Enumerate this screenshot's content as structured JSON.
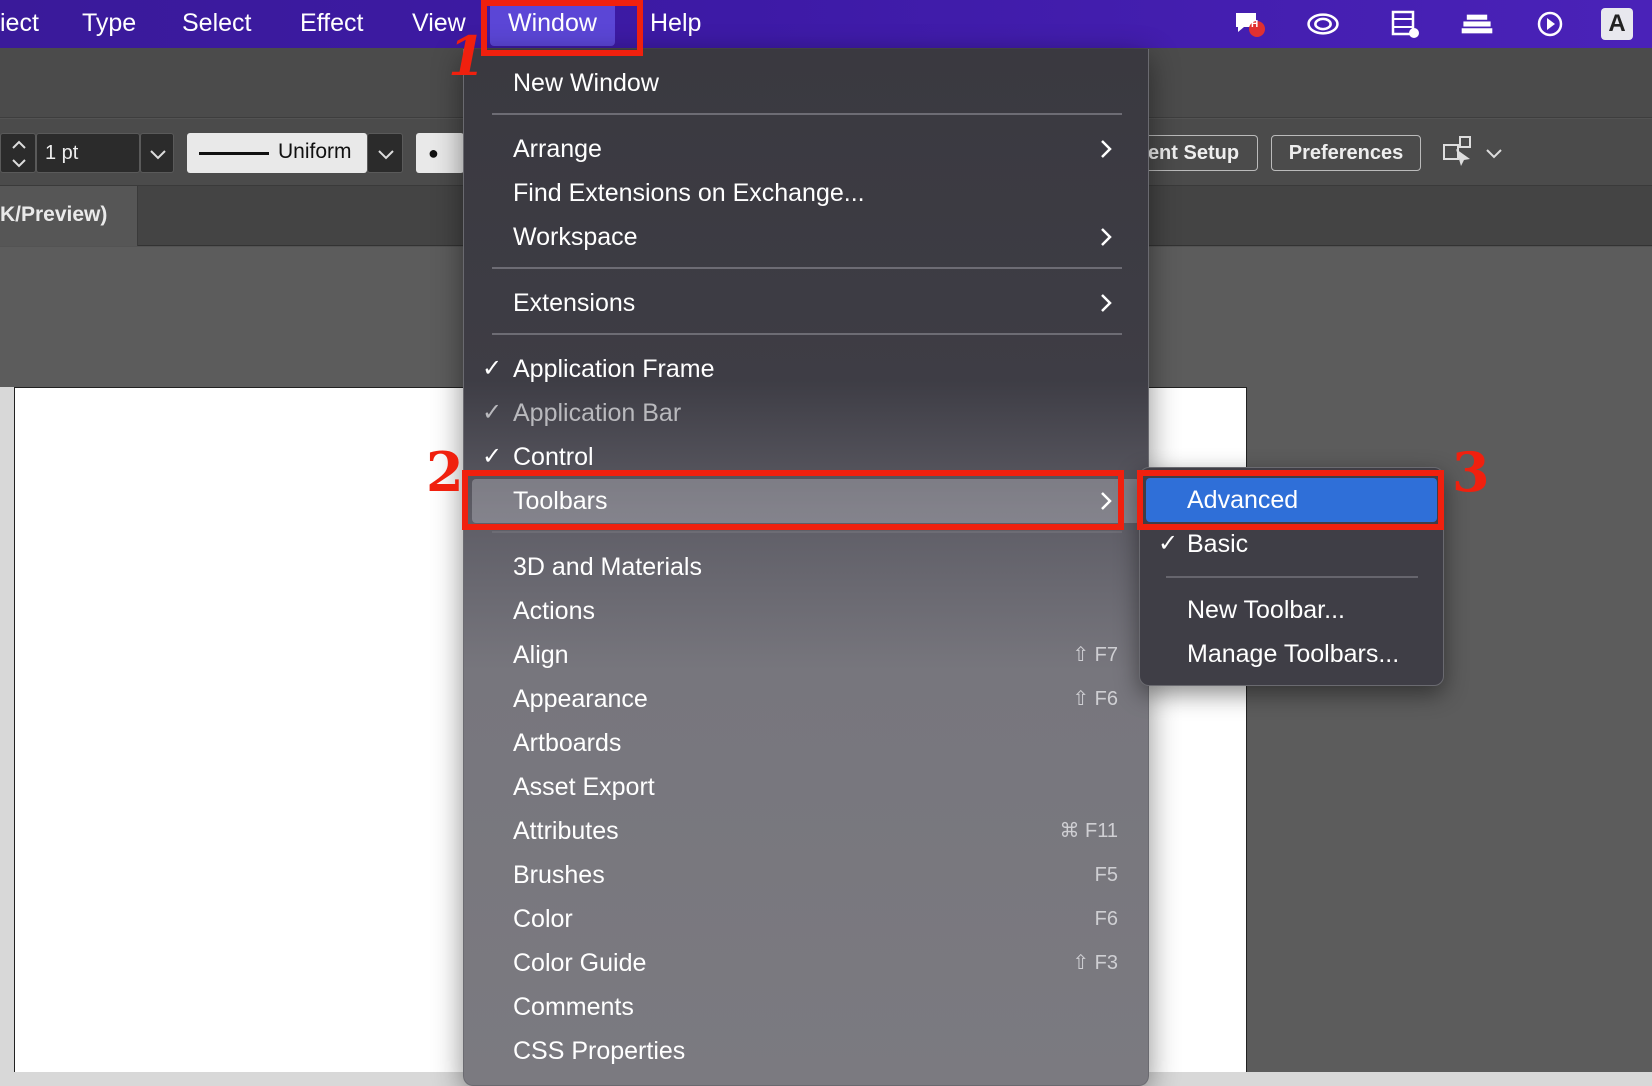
{
  "menubar": {
    "items": [
      "iect",
      "Type",
      "Select",
      "Effect",
      "View",
      "Window",
      "Help"
    ],
    "active": "Window",
    "tray_icons": [
      "chat-notification-icon",
      "creative-cloud-icon",
      "film-icon",
      "stacked-layers-icon",
      "play-circle-icon",
      "a-input-icon"
    ],
    "tray_badge": "H",
    "input_letter": "A"
  },
  "control_bar": {
    "stroke_weight": "1 pt",
    "stroke_profile": "Uniform",
    "brush_dot": "●",
    "setup_button": "ent Setup",
    "preferences_button": "Preferences"
  },
  "doc_tab": {
    "label": "K/Preview)"
  },
  "window_menu": {
    "items": [
      {
        "label": "New Window"
      },
      {
        "label": "Arrange",
        "submenu": true
      },
      {
        "label": "Find Extensions on Exchange..."
      },
      {
        "label": "Workspace",
        "submenu": true
      },
      {
        "label": "Extensions",
        "submenu": true
      },
      {
        "label": "Application Frame",
        "checked": true
      },
      {
        "label": "Application Bar",
        "checked": true,
        "disabled": true
      },
      {
        "label": "Control",
        "checked": true
      },
      {
        "label": "Toolbars",
        "submenu": true,
        "highlighted": true
      },
      {
        "label": "3D and Materials"
      },
      {
        "label": "Actions"
      },
      {
        "label": "Align",
        "shortcut": "⇧ F7"
      },
      {
        "label": "Appearance",
        "shortcut": "⇧ F6"
      },
      {
        "label": "Artboards"
      },
      {
        "label": "Asset Export"
      },
      {
        "label": "Attributes",
        "shortcut": "⌘ F11"
      },
      {
        "label": "Brushes",
        "shortcut": "F5"
      },
      {
        "label": "Color",
        "shortcut": "F6"
      },
      {
        "label": "Color Guide",
        "shortcut": "⇧ F3"
      },
      {
        "label": "Comments"
      },
      {
        "label": "CSS Properties"
      }
    ],
    "check_mark": "✓"
  },
  "toolbars_submenu": {
    "items": [
      {
        "label": "Advanced",
        "selected": true
      },
      {
        "label": "Basic",
        "checked": true
      },
      {
        "label": "New Toolbar..."
      },
      {
        "label": "Manage Toolbars..."
      }
    ]
  },
  "annotations": {
    "step1": "1",
    "step2": "2",
    "step3": "3",
    "color": "#f0200e"
  },
  "colors": {
    "menubar": "#3d1aa6",
    "selection_blue": "#2f6fd8",
    "annotation_red": "#f0200e"
  }
}
